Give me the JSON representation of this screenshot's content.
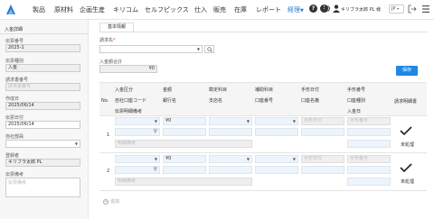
{
  "nav": {
    "items": [
      "製品",
      "原材料",
      "企画生産",
      "キリコム",
      "セルフピックス",
      "仕入",
      "販売",
      "在庫",
      "レポート",
      "経理"
    ],
    "active": "経理",
    "user": "キリブラ太郎 PL 様",
    "lang": "JP"
  },
  "left": {
    "title": "入金詳細",
    "slip_no": {
      "label": "伝票番号",
      "value": "2025-1"
    },
    "slip_type": {
      "label": "伝票種別",
      "value": "入金"
    },
    "billing_no": {
      "label": "請求書番号",
      "placeholder": "請求書番号"
    },
    "created": {
      "label": "作成日",
      "value": "2025/06/14"
    },
    "slip_date": {
      "label": "伝票日付",
      "value": "2025/06/14"
    },
    "company": {
      "label": "自社部員",
      "value": ""
    },
    "registrant": {
      "label": "登録者",
      "value": "キリブラ太郎 PL"
    },
    "remarks": {
      "label": "伝票備考",
      "placeholder": "伝票備考"
    }
  },
  "main": {
    "tab": "基本情報",
    "billing_to": {
      "label": "請求先",
      "required": "*",
      "value": ""
    },
    "total": {
      "label": "入金額合計",
      "value": "¥0"
    },
    "save": "保存"
  },
  "table": {
    "headers": {
      "no": "No.",
      "c1": [
        "入金区分",
        "自社口座コード",
        "伝票明細備考"
      ],
      "c2": [
        "金額",
        "銀行名"
      ],
      "c3": [
        "勘定科目",
        "支店名"
      ],
      "c4": [
        "補助科目",
        "口座番号"
      ],
      "c5": [
        "手形日付",
        "口座名義"
      ],
      "c6": [
        "手形番号",
        "口座種別",
        "入金日"
      ],
      "c7": "請求明細書"
    },
    "rows": [
      {
        "no": "1",
        "amount": "¥0",
        "note_ph": "明細備考",
        "date_ph": "手形日付",
        "num_ph": "手形番号",
        "status": "未処理"
      },
      {
        "no": "2",
        "amount": "¥0",
        "note_ph": "明細備考",
        "date_ph": "手形日付",
        "num_ph": "手形番号",
        "status": "未処理"
      }
    ],
    "add_label": "追加"
  }
}
